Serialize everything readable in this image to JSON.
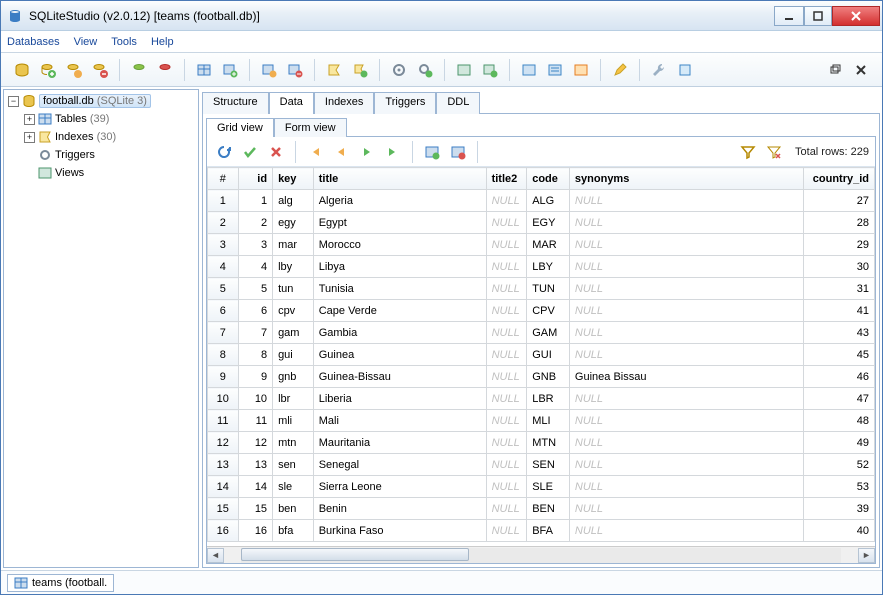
{
  "window": {
    "title": "SQLiteStudio (v2.0.12) [teams (football.db)]"
  },
  "menu": [
    "Databases",
    "View",
    "Tools",
    "Help"
  ],
  "tree": {
    "db_label": "football.db",
    "db_engine": "(SQLite 3)",
    "tables_label": "Tables",
    "tables_count": "(39)",
    "indexes_label": "Indexes",
    "indexes_count": "(30)",
    "triggers_label": "Triggers",
    "views_label": "Views"
  },
  "tabs_main": {
    "structure": "Structure",
    "data": "Data",
    "indexes": "Indexes",
    "triggers": "Triggers",
    "ddl": "DDL"
  },
  "tabs_view": {
    "grid": "Grid view",
    "form": "Form view"
  },
  "total_rows": "Total rows: 229",
  "columns": {
    "idx": "#",
    "id": "id",
    "key": "key",
    "title": "title",
    "title2": "title2",
    "code": "code",
    "synonyms": "synonyms",
    "country_id": "country_id"
  },
  "null_text": "NULL",
  "rows": [
    {
      "n": 1,
      "id": 1,
      "key": "alg",
      "title": "Algeria",
      "code": "ALG",
      "syn": null,
      "cid": 27
    },
    {
      "n": 2,
      "id": 2,
      "key": "egy",
      "title": "Egypt",
      "code": "EGY",
      "syn": null,
      "cid": 28
    },
    {
      "n": 3,
      "id": 3,
      "key": "mar",
      "title": "Morocco",
      "code": "MAR",
      "syn": null,
      "cid": 29
    },
    {
      "n": 4,
      "id": 4,
      "key": "lby",
      "title": "Libya",
      "code": "LBY",
      "syn": null,
      "cid": 30
    },
    {
      "n": 5,
      "id": 5,
      "key": "tun",
      "title": "Tunisia",
      "code": "TUN",
      "syn": null,
      "cid": 31
    },
    {
      "n": 6,
      "id": 6,
      "key": "cpv",
      "title": "Cape Verde",
      "code": "CPV",
      "syn": null,
      "cid": 41
    },
    {
      "n": 7,
      "id": 7,
      "key": "gam",
      "title": "Gambia",
      "code": "GAM",
      "syn": null,
      "cid": 43
    },
    {
      "n": 8,
      "id": 8,
      "key": "gui",
      "title": "Guinea",
      "code": "GUI",
      "syn": null,
      "cid": 45
    },
    {
      "n": 9,
      "id": 9,
      "key": "gnb",
      "title": "Guinea-Bissau",
      "code": "GNB",
      "syn": "Guinea Bissau",
      "cid": 46
    },
    {
      "n": 10,
      "id": 10,
      "key": "lbr",
      "title": "Liberia",
      "code": "LBR",
      "syn": null,
      "cid": 47
    },
    {
      "n": 11,
      "id": 11,
      "key": "mli",
      "title": "Mali",
      "code": "MLI",
      "syn": null,
      "cid": 48
    },
    {
      "n": 12,
      "id": 12,
      "key": "mtn",
      "title": "Mauritania",
      "code": "MTN",
      "syn": null,
      "cid": 49
    },
    {
      "n": 13,
      "id": 13,
      "key": "sen",
      "title": "Senegal",
      "code": "SEN",
      "syn": null,
      "cid": 52
    },
    {
      "n": 14,
      "id": 14,
      "key": "sle",
      "title": "Sierra Leone",
      "code": "SLE",
      "syn": null,
      "cid": 53
    },
    {
      "n": 15,
      "id": 15,
      "key": "ben",
      "title": "Benin",
      "code": "BEN",
      "syn": null,
      "cid": 39
    },
    {
      "n": 16,
      "id": 16,
      "key": "bfa",
      "title": "Burkina Faso",
      "code": "BFA",
      "syn": null,
      "cid": 40
    }
  ],
  "status": {
    "item": "teams (football."
  }
}
